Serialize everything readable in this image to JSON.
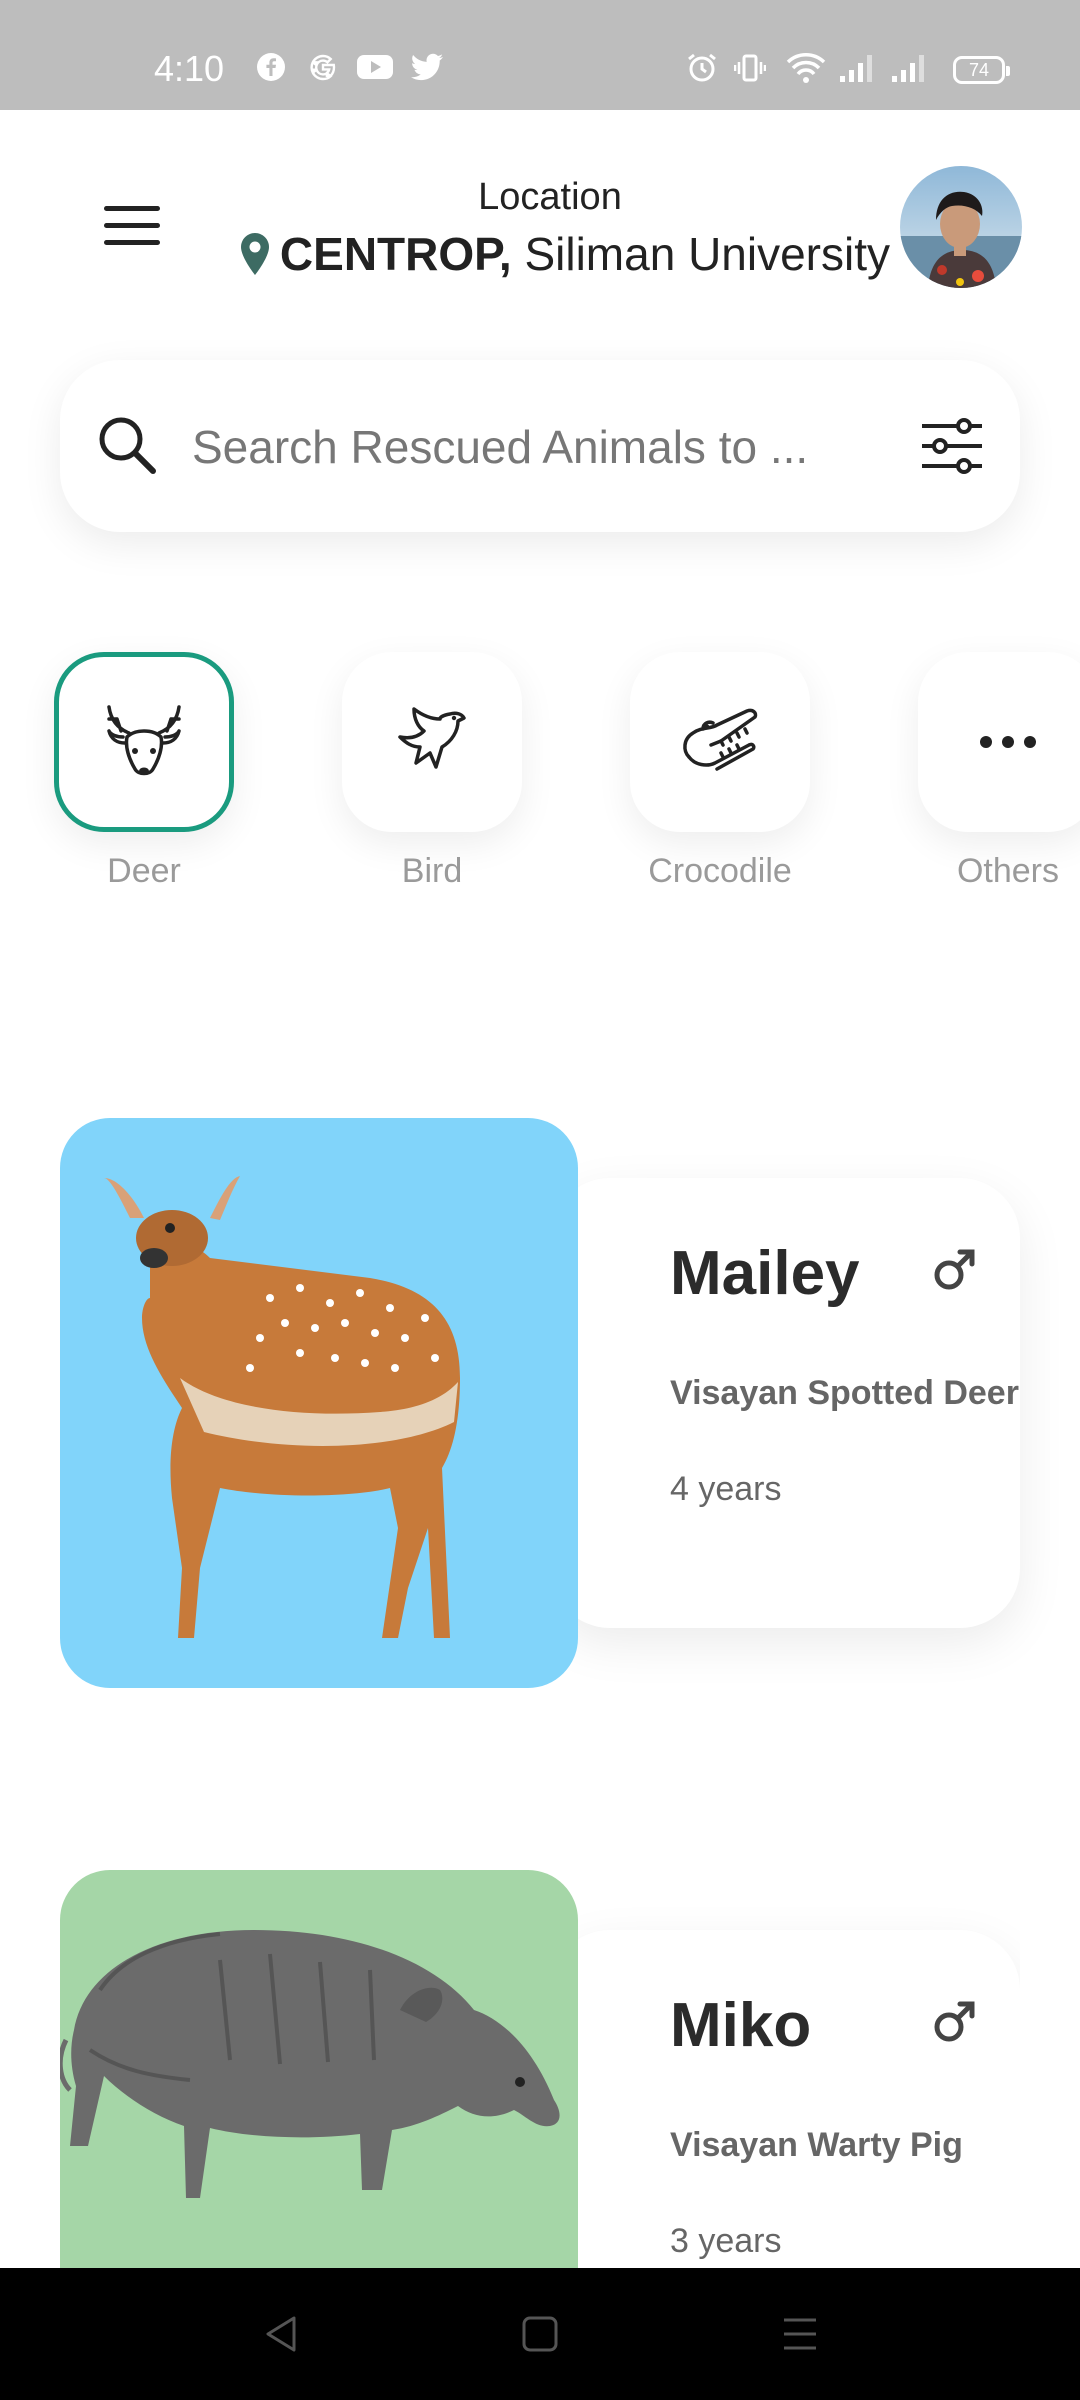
{
  "status_bar": {
    "time": "4:10",
    "battery": "74",
    "icons": [
      "facebook-icon",
      "google-icon",
      "youtube-icon",
      "twitter-icon",
      "alarm-icon",
      "vibrate-icon",
      "wifi-icon",
      "signal-icon",
      "signal-icon"
    ]
  },
  "header": {
    "location_caption": "Location",
    "location_bold": "CENTROP,",
    "location_rest": " Siliman University"
  },
  "search": {
    "placeholder": "Search Rescued Animals to ..."
  },
  "categories": [
    {
      "label": "Deer",
      "icon": "deer-icon",
      "active": true
    },
    {
      "label": "Bird",
      "icon": "bird-icon",
      "active": false
    },
    {
      "label": "Crocodile",
      "icon": "crocodile-icon",
      "active": false
    },
    {
      "label": "Others",
      "icon": "more-icon",
      "active": false
    }
  ],
  "pets": [
    {
      "name": "Mailey",
      "breed": "Visayan Spotted Deer",
      "age": "4 years",
      "gender_icon": "male-icon",
      "photo_bg": "#81d4fa"
    },
    {
      "name": "Miko",
      "breed": "Visayan Warty Pig",
      "age": "3 years",
      "gender_icon": "male-icon",
      "photo_bg": "#a5d6a7"
    }
  ],
  "colors": {
    "accent": "#1a9b7f",
    "status_bar": "#bdbdbd",
    "pin": "#3d6b63"
  }
}
